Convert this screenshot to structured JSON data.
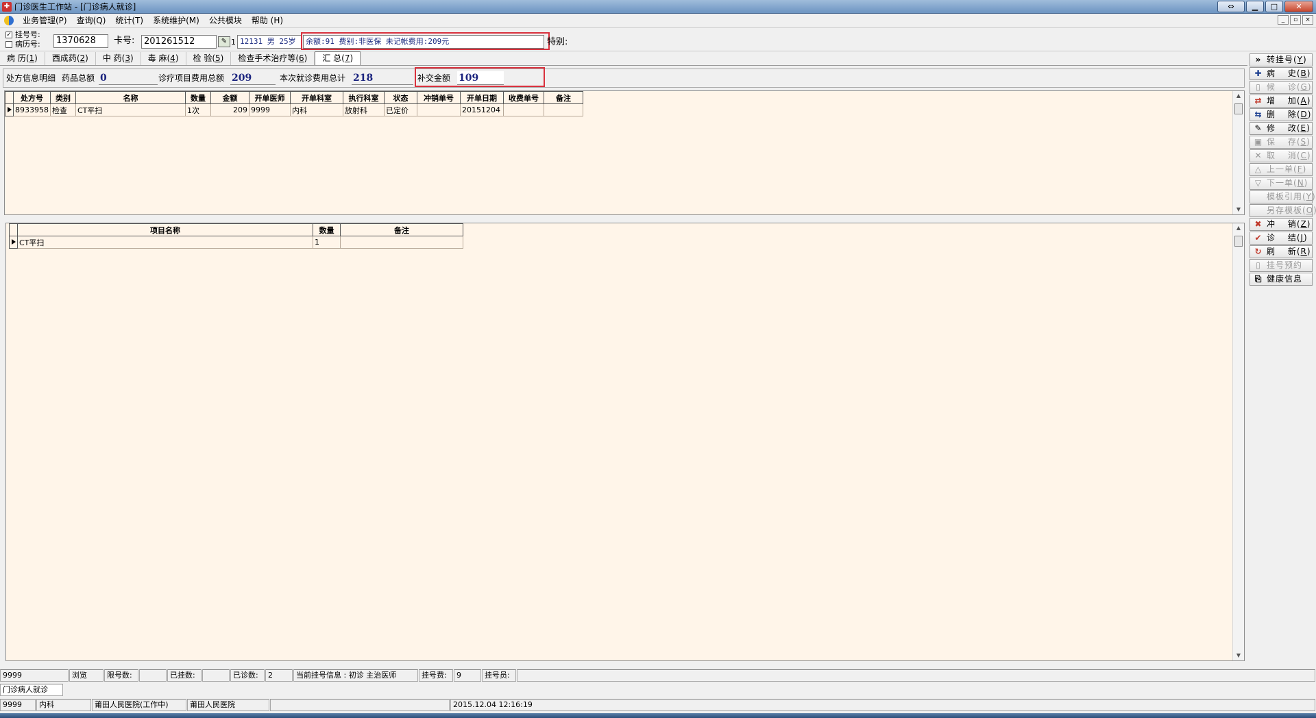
{
  "window": {
    "title": "门诊医生工作站 - [门诊病人就诊]"
  },
  "menu": [
    "业务管理(P)",
    "查询(Q)",
    "统计(T)",
    "系统维护(M)",
    "公共模块",
    "帮助 (H)"
  ],
  "patient": {
    "reg_label": "挂号号:",
    "record_label": "病历号:",
    "reg_no": "1370628",
    "card_label": "卡号:",
    "card_no": "201261512",
    "info": "12131 男 25岁",
    "balance_info": "余额:91 费别:非医保 未记帐费用:209元",
    "special_label": "特别:"
  },
  "tabs": [
    {
      "label": "病 历(",
      "key": "1"
    },
    {
      "label": "西成药(",
      "key": "2"
    },
    {
      "label": "中 药(",
      "key": "3"
    },
    {
      "label": "毒 麻(",
      "key": "4"
    },
    {
      "label": "检 验(",
      "key": "5"
    },
    {
      "label": "检查手术治疗等(",
      "key": "6"
    },
    {
      "label": "汇 总(",
      "key": "7"
    }
  ],
  "summary": {
    "section_label": "处方信息明细",
    "drug_total_label": "药品总额",
    "drug_total": "0",
    "treat_total_label": "诊疗项目费用总额",
    "treat_total": "209",
    "visit_total_label": "本次就诊费用总计",
    "visit_total": "218",
    "supplement_label": "补交金额",
    "supplement": "109"
  },
  "top_grid": {
    "headers": [
      "处方号",
      "类别",
      "名称",
      "数量",
      "金额",
      "开单医师",
      "开单科室",
      "执行科室",
      "状态",
      "冲销单号",
      "开单日期",
      "收费单号",
      "备注"
    ],
    "rows": [
      [
        "8933958",
        "检查",
        "CT平扫",
        "1次",
        "209",
        "9999",
        "内科",
        "放射科",
        "已定价",
        "",
        "20151204",
        "",
        ""
      ]
    ]
  },
  "bottom_grid": {
    "headers": [
      "项目名称",
      "数量",
      "备注"
    ],
    "rows": [
      [
        "CT平扫",
        "1",
        ""
      ]
    ]
  },
  "toolbar": [
    {
      "label": "转挂号(",
      "key": "Y",
      "icon": "»",
      "icon_name": "double-chevron-icon",
      "disabled": false,
      "color": "#000"
    },
    {
      "label": "病　 史(",
      "key": "B",
      "icon": "✚",
      "icon_name": "plus-icon",
      "disabled": false,
      "color": "#1a3d8f"
    },
    {
      "label": "候　 诊(",
      "key": "G",
      "icon": "▯",
      "icon_name": "document-icon",
      "disabled": true,
      "color": "#999"
    },
    {
      "label": "增　 加(",
      "key": "A",
      "icon": "⇄",
      "icon_name": "add-row-icon",
      "disabled": false,
      "color": "#c0392b"
    },
    {
      "label": "删　 除(",
      "key": "D",
      "icon": "⇆",
      "icon_name": "delete-row-icon",
      "disabled": false,
      "color": "#1a3d8f"
    },
    {
      "label": "修　 改(",
      "key": "E",
      "icon": "✎",
      "icon_name": "edit-icon",
      "disabled": false,
      "color": "#000"
    },
    {
      "label": "保　 存(",
      "key": "S",
      "icon": "▣",
      "icon_name": "save-icon",
      "disabled": true,
      "color": "#999"
    },
    {
      "label": "取　 消(",
      "key": "C",
      "icon": "✕",
      "icon_name": "cancel-icon",
      "disabled": true,
      "color": "#999"
    },
    {
      "label": "上一单(",
      "key": "F",
      "icon": "△",
      "icon_name": "prev-icon",
      "disabled": true,
      "color": "#999"
    },
    {
      "label": "下一单(",
      "key": "N",
      "icon": "▽",
      "icon_name": "next-icon",
      "disabled": true,
      "color": "#999"
    },
    {
      "label": "模板引用(",
      "key": "Y",
      "icon": "",
      "icon_name": "",
      "disabled": true,
      "color": "#999"
    },
    {
      "label": "另存模板(",
      "key": "O",
      "icon": "",
      "icon_name": "",
      "disabled": true,
      "color": "#999"
    },
    {
      "label": "冲　 销(",
      "key": "Z",
      "icon": "✖",
      "icon_name": "reverse-icon",
      "disabled": false,
      "color": "#c0392b"
    },
    {
      "label": "诊　 结(",
      "key": "J",
      "icon": "✔",
      "icon_name": "check-icon",
      "disabled": false,
      "color": "#c0392b"
    },
    {
      "label": "刷　 新(",
      "key": "R",
      "icon": "↻",
      "icon_name": "refresh-icon",
      "disabled": false,
      "color": "#c0392b"
    },
    {
      "label": "挂号预约",
      "key": "",
      "icon": "▯",
      "icon_name": "appointment-icon",
      "disabled": true,
      "color": "#999"
    },
    {
      "label": "健康信息",
      "key": "",
      "icon": "⎘",
      "icon_name": "health-info-icon",
      "disabled": false,
      "color": "#000"
    }
  ],
  "status1": [
    "9999",
    "浏览",
    "限号数:",
    "",
    "已挂数:",
    "",
    "已诊数:",
    "2",
    "当前挂号信息 : 初诊 主治医师",
    "挂号费:",
    "9",
    "挂号员:",
    ""
  ],
  "tab_strip": "门诊病人就诊",
  "status2": [
    "9999",
    "内科",
    "莆田人民医院(工作中)",
    "莆田人民医院",
    "",
    "2015.12.04 12:16:19"
  ]
}
